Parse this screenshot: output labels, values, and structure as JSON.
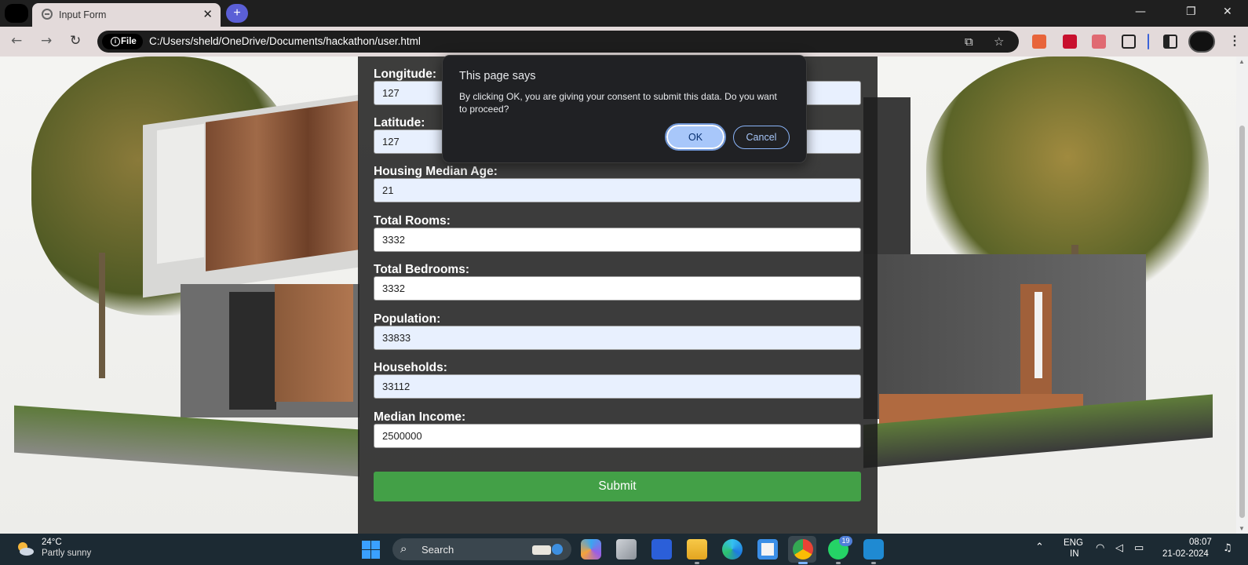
{
  "browser": {
    "tab_title": "Input Form",
    "tab_close": "✕",
    "new_tab": "+",
    "security_chip": "File",
    "url": "C:/Users/sheld/OneDrive/Documents/hackathon/user.html",
    "window_controls": {
      "minimize": "—",
      "restore": "❐",
      "close": "✕"
    },
    "nav": {
      "back": "←",
      "forward": "→",
      "reload": "↻"
    },
    "menu": "⋮"
  },
  "form": {
    "fields": [
      {
        "label": "Longitude:",
        "value": "127",
        "autofill": true
      },
      {
        "label": "Latitude:",
        "value": "127",
        "autofill": true
      },
      {
        "label": "Housing Median Age:",
        "value": "21",
        "autofill": true
      },
      {
        "label": "Total Rooms:",
        "value": "3332",
        "autofill": false
      },
      {
        "label": "Total Bedrooms:",
        "value": "3332",
        "autofill": false
      },
      {
        "label": "Population:",
        "value": "33833",
        "autofill": true
      },
      {
        "label": "Households:",
        "value": "33112",
        "autofill": true
      },
      {
        "label": "Median Income:",
        "value": "2500000",
        "autofill": false
      }
    ],
    "submit_label": "Submit"
  },
  "dialog": {
    "title": "This page says",
    "message": "By clicking OK, you are giving your consent to submit this data. Do you want to proceed?",
    "ok_label": "OK",
    "cancel_label": "Cancel"
  },
  "taskbar": {
    "weather_temp": "24°C",
    "weather_desc": "Partly sunny",
    "search_label": "Search",
    "notification_badge": "19",
    "language_line1": "ENG",
    "language_line2": "IN",
    "time": "08:07",
    "date": "21-02-2024",
    "apps": [
      "copilot-icon",
      "task-view-icon",
      "azure-icon",
      "file-explorer-icon",
      "edge-icon",
      "store-icon",
      "chrome-icon",
      "whatsapp-icon",
      "vscode-icon"
    ]
  },
  "colors": {
    "submit_green": "#43a047",
    "dialog_bg": "#202124",
    "ok_blue": "#a8c7fa",
    "taskbar": "#1c2a33"
  }
}
